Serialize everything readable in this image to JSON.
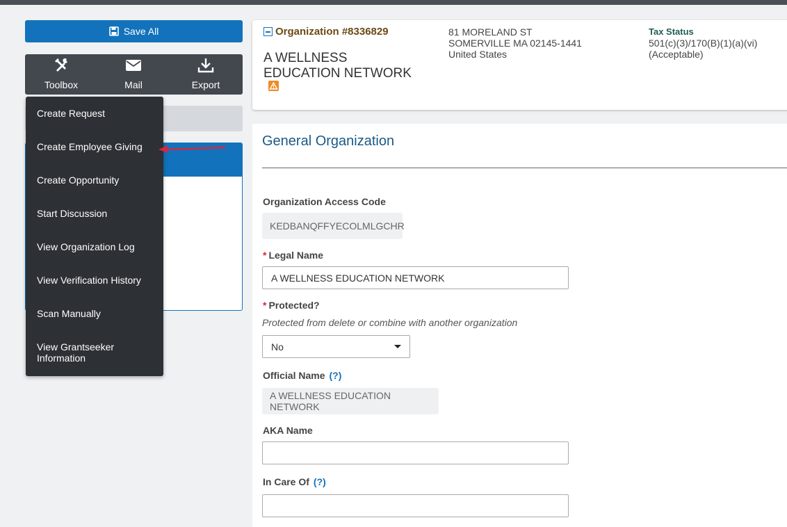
{
  "toolbar": {
    "save_all": "Save All",
    "tools": [
      {
        "label": "Toolbox",
        "icon": "toolbox-icon"
      },
      {
        "label": "Mail",
        "icon": "mail-icon"
      },
      {
        "label": "Export",
        "icon": "export-icon"
      }
    ]
  },
  "toolbox_menu": {
    "items": [
      "Create Request",
      "Create Employee Giving",
      "Create Opportunity",
      "Start Discussion",
      "View Organization Log",
      "View Verification History",
      "Scan Manually",
      "View Grantseeker Information"
    ]
  },
  "org": {
    "id_label": "Organization #8336829",
    "name": "A WELLNESS EDUCATION NETWORK",
    "address_line1": "81 MORELAND ST",
    "address_line2": "SOMERVILLE MA 02145-1441",
    "country": "United States",
    "tax_status_label": "Tax Status",
    "tax_status_code": "501(c)(3)/170(B)(1)(a)(vi)",
    "tax_status_note": "(Acceptable)"
  },
  "form": {
    "section_title": "General Organization",
    "access_code_label": "Organization Access Code",
    "access_code_value": "KEDBANQFFYECOLMLGCHR",
    "required_mark": "*",
    "legal_name_label": "Legal Name",
    "legal_name_value": "A WELLNESS EDUCATION NETWORK",
    "protected_label": "Protected?",
    "protected_hint": "Protected from delete or combine with another organization",
    "protected_value": "No",
    "official_name_label": "Official Name",
    "official_name_value": "A WELLNESS EDUCATION NETWORK",
    "help_mark": "(?)",
    "aka_name_label": "AKA Name",
    "aka_name_value": "",
    "in_care_of_label": "In Care Of",
    "in_care_of_value": ""
  },
  "colors": {
    "primary": "#1272bb",
    "toolbar_bg": "#43474e",
    "menu_bg": "#2d3035",
    "org_id": "#6b4a16",
    "annotation_arrow": "#d7263d"
  }
}
